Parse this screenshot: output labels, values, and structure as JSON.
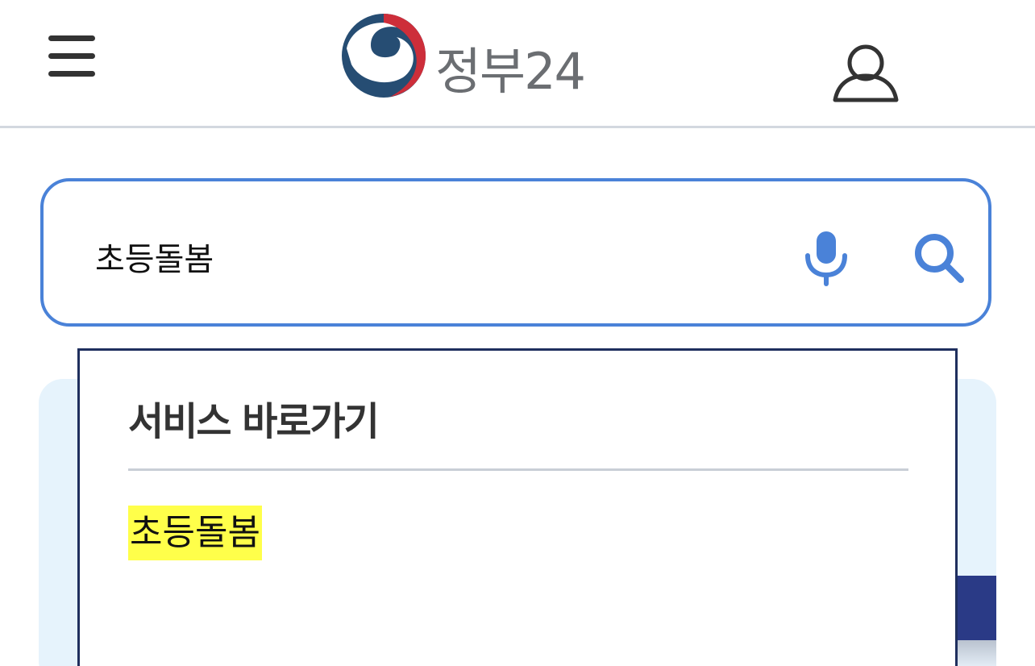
{
  "header": {
    "logo_text": "정부24",
    "menu_icon": "hamburger-menu-icon",
    "user_icon": "user-icon",
    "logo_colors": {
      "blue": "#264d73",
      "red": "#cd2e3a"
    }
  },
  "search": {
    "value": "초등돌봄",
    "mic_icon": "microphone-icon",
    "search_icon": "search-icon",
    "accent": "#4a82d8"
  },
  "dropdown": {
    "title": "서비스 바로가기",
    "suggestions": [
      {
        "label": "초등돌봄",
        "highlight": "#ffff4a"
      }
    ]
  }
}
